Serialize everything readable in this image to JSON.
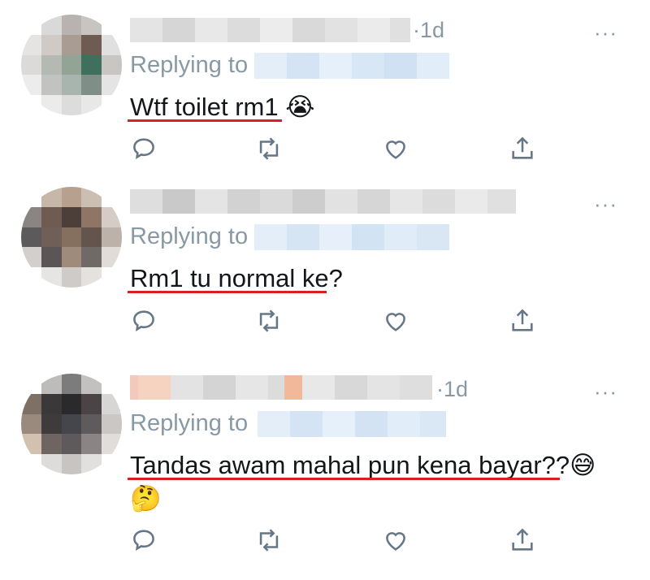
{
  "colors": {
    "muted": "#8899a6",
    "text": "#14171a",
    "underline": "#e01b24",
    "handle_blur": "#dbe9f6"
  },
  "tweets": [
    {
      "time": "·1d",
      "more": "···",
      "replying_to": "Replying to",
      "text": "Wtf toilet rm1 😭",
      "actions": [
        "reply-icon",
        "retweet-icon",
        "like-icon",
        "share-icon"
      ]
    },
    {
      "time": "",
      "more": "···",
      "replying_to": "Replying to",
      "text": "Rm1 tu normal ke?",
      "actions": [
        "reply-icon",
        "retweet-icon",
        "like-icon",
        "share-icon"
      ]
    },
    {
      "time": "·1d",
      "more": "···",
      "replying_to": "Replying to",
      "text": "Tandas awam mahal pun kena bayar??😅",
      "text2": "🤔",
      "actions": [
        "reply-icon",
        "retweet-icon",
        "like-icon",
        "share-icon"
      ]
    }
  ]
}
